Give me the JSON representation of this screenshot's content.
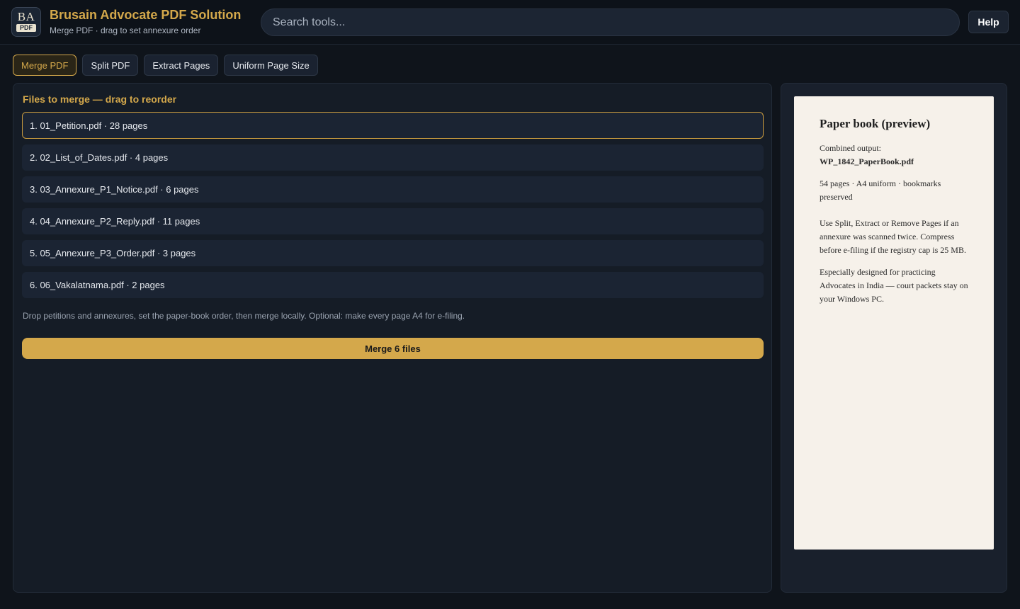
{
  "header": {
    "logo_top": "BA",
    "logo_bottom": "PDF",
    "title": "Brusain Advocate PDF Solution",
    "subtitle": "Merge PDF · drag to set annexure order",
    "search_placeholder": "Search tools...",
    "help_label": "Help"
  },
  "tabs": [
    {
      "label": "Merge PDF",
      "active": true
    },
    {
      "label": "Split PDF",
      "active": false
    },
    {
      "label": "Extract Pages",
      "active": false
    },
    {
      "label": "Uniform Page Size",
      "active": false
    }
  ],
  "merge": {
    "heading": "Files to merge — drag to reorder",
    "files": [
      "1. 01_Petition.pdf · 28 pages",
      "2. 02_List_of_Dates.pdf · 4 pages",
      "3. 03_Annexure_P1_Notice.pdf · 6 pages",
      "4. 04_Annexure_P2_Reply.pdf · 11 pages",
      "5. 05_Annexure_P3_Order.pdf · 3 pages",
      "6. 06_Vakalatnama.pdf · 2 pages"
    ],
    "hint": "Drop petitions and annexures, set the paper-book order, then merge locally. Optional: make every page A4 for e-filing.",
    "merge_button": "Merge 6 files"
  },
  "preview": {
    "title": "Paper book (preview)",
    "output_label": "Combined output:",
    "output_filename": "WP_1842_PaperBook.pdf",
    "stats": "54 pages · A4 uniform · bookmarks preserved",
    "note1": "Use Split, Extract or Remove Pages if an annexure was scanned twice. Compress before e-filing if the registry cap is 25 MB.",
    "note2": "Especially designed for practicing Advocates in India — court packets stay on your Windows PC."
  },
  "colors": {
    "accent": "#d4a84b",
    "background": "#0f141b",
    "paper": "#f6f1ea"
  }
}
